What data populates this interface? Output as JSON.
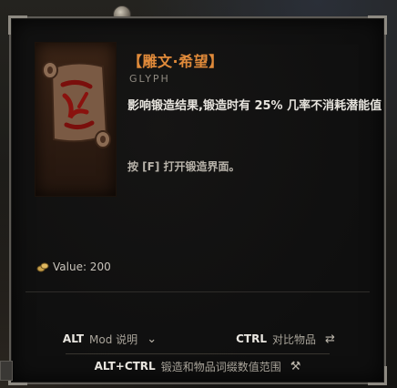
{
  "item": {
    "title": "【雕文·希望】",
    "subtitle": "GLYPH",
    "description": "影响锻造结果,锻造时有 25% 几率不消耗潜能值",
    "hint": "按 [F] 打开锻造界面。",
    "value_label": "Value: 200"
  },
  "footer": {
    "alt_key": "ALT",
    "alt_desc": "Mod 说明",
    "ctrl_key": "CTRL",
    "ctrl_desc": "对比物品",
    "altctrl_key": "ALT+CTRL",
    "altctrl_desc": "锻造和物品词缀数值范围"
  },
  "icons": {
    "item_icon": "scroll-glyph-icon",
    "value_icon": "gold-coins-icon",
    "alt_icon": "chevron-down-icon",
    "ctrl_icon": "compare-arrows-icon",
    "altctrl_icon": "hammer-icon"
  },
  "colors": {
    "title": "#e08a3a",
    "background": "#0f0f0f",
    "border": "#5d5a55"
  }
}
